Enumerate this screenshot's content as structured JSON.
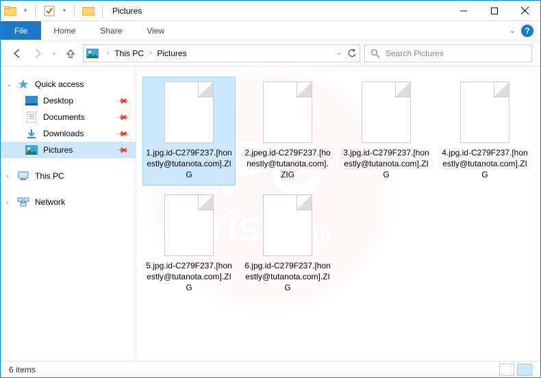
{
  "window": {
    "title": "Pictures"
  },
  "ribbon": {
    "file": "File",
    "tabs": [
      "Home",
      "Share",
      "View"
    ]
  },
  "breadcrumb": {
    "segments": [
      "This PC",
      "Pictures"
    ]
  },
  "search": {
    "placeholder": "Search Pictures"
  },
  "sidebar": {
    "quick_access": "Quick access",
    "items": [
      {
        "label": "Desktop",
        "pinned": true
      },
      {
        "label": "Documents",
        "pinned": true
      },
      {
        "label": "Downloads",
        "pinned": true
      },
      {
        "label": "Pictures",
        "pinned": true,
        "selected": true
      }
    ],
    "this_pc": "This PC",
    "network": "Network"
  },
  "files": [
    {
      "name": "1.jpg.id-C279F237.[honestly@tutanota.com].ZIG",
      "selected": true
    },
    {
      "name": "2.jpeg.id-C279F237.[honestly@tutanota.com].ZIG"
    },
    {
      "name": "3.jpg.id-C279F237.[honestly@tutanota.com].ZIG"
    },
    {
      "name": "4.jpg.id-C279F237.[honestly@tutanota.com].ZIG"
    },
    {
      "name": "5.jpg.id-C279F237.[honestly@tutanota.com].ZIG"
    },
    {
      "name": "6.jpg.id-C279F237.[honestly@tutanota.com].ZIG"
    }
  ],
  "status": {
    "count": "6 items"
  }
}
